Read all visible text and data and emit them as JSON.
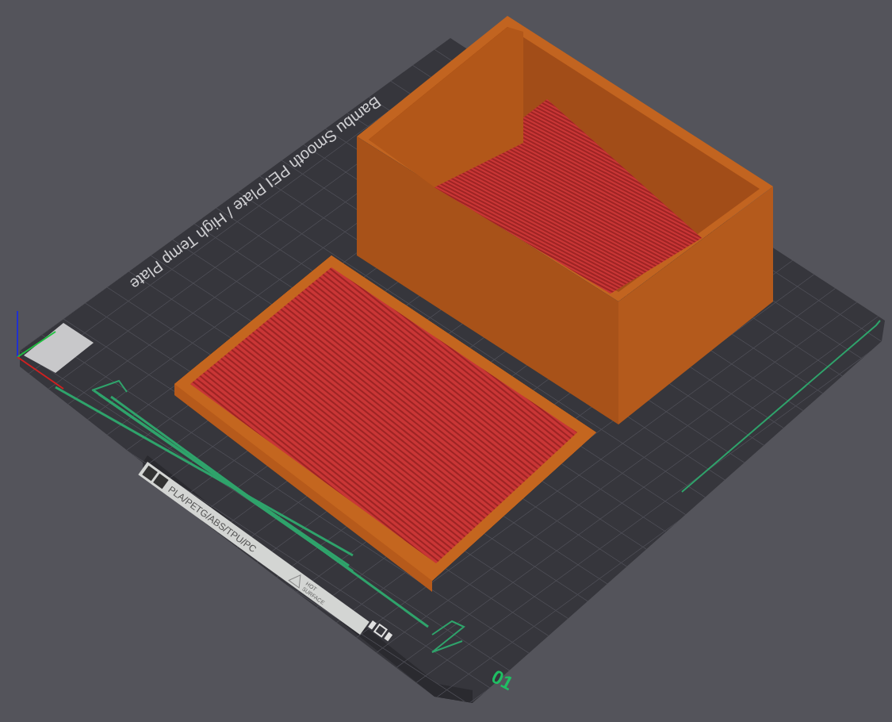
{
  "plate": {
    "title": "Bambu Smooth PEI Plate / High Temp Plate",
    "materials": "PLA/PETG/ABS/TPU/PC",
    "warning": [
      "HOT",
      "SURFACE"
    ],
    "number": "01"
  }
}
